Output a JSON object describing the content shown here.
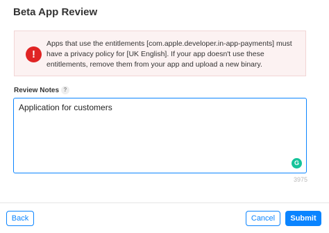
{
  "dialog": {
    "title": "Beta App Review"
  },
  "alert": {
    "icon": "exclamation-icon",
    "text": "Apps that use the entitlements [com.apple.developer.in-app-payments] must have a privacy policy for [UK English]. If your app doesn't use these entitlements, remove them from your app and upload a new binary.",
    "icon_color": "#e02424",
    "background_color": "#fcf2f2"
  },
  "review_notes": {
    "label": "Review Notes",
    "help_glyph": "?",
    "value": "Application for customers",
    "remaining_chars": "3975"
  },
  "grammarly": {
    "icon": "grammarly-icon",
    "glyph": "G"
  },
  "footer": {
    "back_label": "Back",
    "cancel_label": "Cancel",
    "submit_label": "Submit",
    "accent_color": "#0a84ff"
  }
}
